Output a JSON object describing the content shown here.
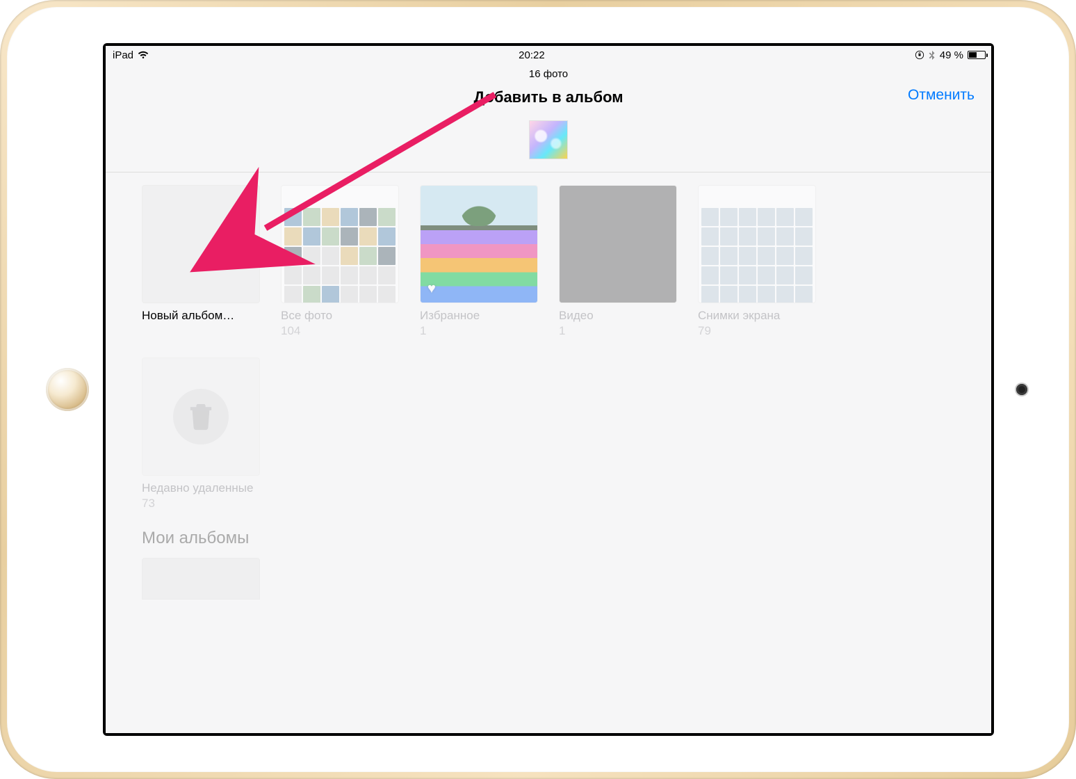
{
  "status_bar": {
    "device": "iPad",
    "time": "20:22",
    "battery_percent": "49 %"
  },
  "header": {
    "photo_count": "16 фото",
    "title": "Добавить в альбом",
    "cancel": "Отменить"
  },
  "albums": {
    "new_album": "Новый альбом…",
    "all_photos": {
      "title": "Все фото",
      "count": "104"
    },
    "favorites": {
      "title": "Избранное",
      "count": "1"
    },
    "videos": {
      "title": "Видео",
      "count": "1"
    },
    "screenshots": {
      "title": "Снимки экрана",
      "count": "79"
    },
    "recently_deleted": {
      "title": "Недавно удаленные",
      "count": "73"
    }
  },
  "sections": {
    "my_albums": "Мои альбомы"
  }
}
